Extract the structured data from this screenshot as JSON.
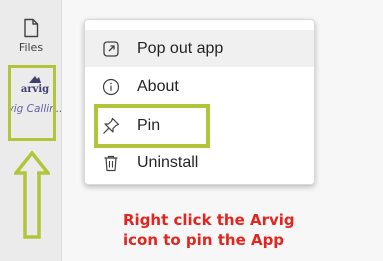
{
  "rail": {
    "files": {
      "label": "Files",
      "icon": "file-icon"
    },
    "app": {
      "logo_text": "arvig",
      "name": "Arvig Callin...",
      "icon": "arvig-logo-icon"
    },
    "more_label": "..."
  },
  "context_menu": {
    "items": [
      {
        "label": "Pop out app",
        "icon": "pop-out-icon",
        "hovered": true
      },
      {
        "label": "About",
        "icon": "info-icon",
        "hovered": false
      },
      {
        "label": "Pin",
        "icon": "pin-icon",
        "hovered": false
      },
      {
        "label": "Uninstall",
        "icon": "trash-icon",
        "hovered": false
      }
    ]
  },
  "annotation": {
    "line1": "Right click the Arvig",
    "line2": "icon to pin the App",
    "text_color": "#e0261f",
    "highlight_color": "#b2c53a"
  }
}
